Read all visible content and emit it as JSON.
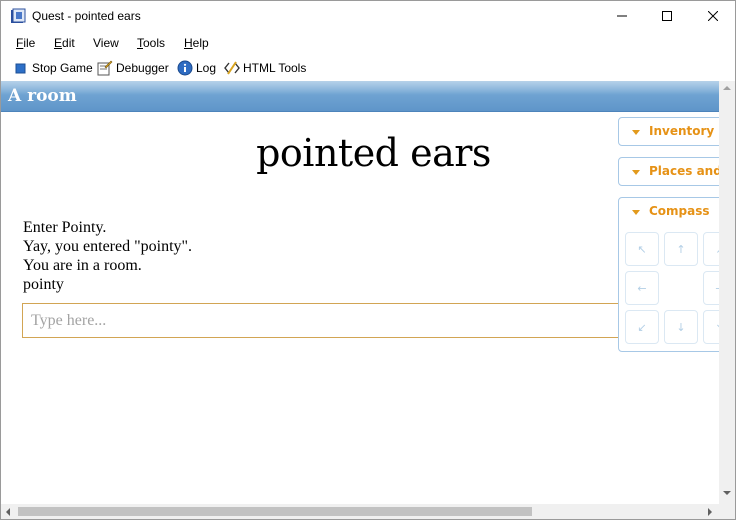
{
  "window": {
    "title": "Quest - pointed ears",
    "controls": {
      "minimize": "minimize-icon",
      "maximize": "maximize-icon",
      "close": "close-icon"
    }
  },
  "menu": {
    "items": [
      {
        "label": "File",
        "accel": "F",
        "rest": "ile"
      },
      {
        "label": "Edit",
        "accel": "E",
        "rest": "dit"
      },
      {
        "label": "View",
        "accel": "",
        "rest": "View"
      },
      {
        "label": "Tools",
        "accel": "T",
        "rest": "ools"
      },
      {
        "label": "Help",
        "accel": "H",
        "rest": "elp"
      }
    ]
  },
  "toolbar": {
    "stop_game": "Stop Game",
    "debugger": "Debugger",
    "log": "Log",
    "html_tools": "HTML Tools"
  },
  "game": {
    "location": "A room",
    "title": "pointed ears",
    "output": [
      "Enter Pointy.",
      "Yay, you entered \"pointy\".",
      "You are in a room.",
      "pointy"
    ],
    "command_placeholder": "Type here...",
    "command_value": ""
  },
  "panes": {
    "inventory": "Inventory",
    "places": "Places and O",
    "compass": "Compass",
    "compass_buttons": [
      {
        "dir": "northwest",
        "glyph": "↖"
      },
      {
        "dir": "north",
        "glyph": "↑"
      },
      {
        "dir": "northeast",
        "glyph": "↗"
      },
      {
        "dir": "west",
        "glyph": "←"
      },
      {
        "dir": "east",
        "glyph": "→"
      },
      {
        "dir": "southwest",
        "glyph": "↙"
      },
      {
        "dir": "south",
        "glyph": "↓"
      },
      {
        "dir": "southeast",
        "glyph": "↘"
      }
    ]
  },
  "colors": {
    "location_bar": "#6fa3d2",
    "pane_label": "#e69216",
    "command_border": "#d2a554"
  }
}
